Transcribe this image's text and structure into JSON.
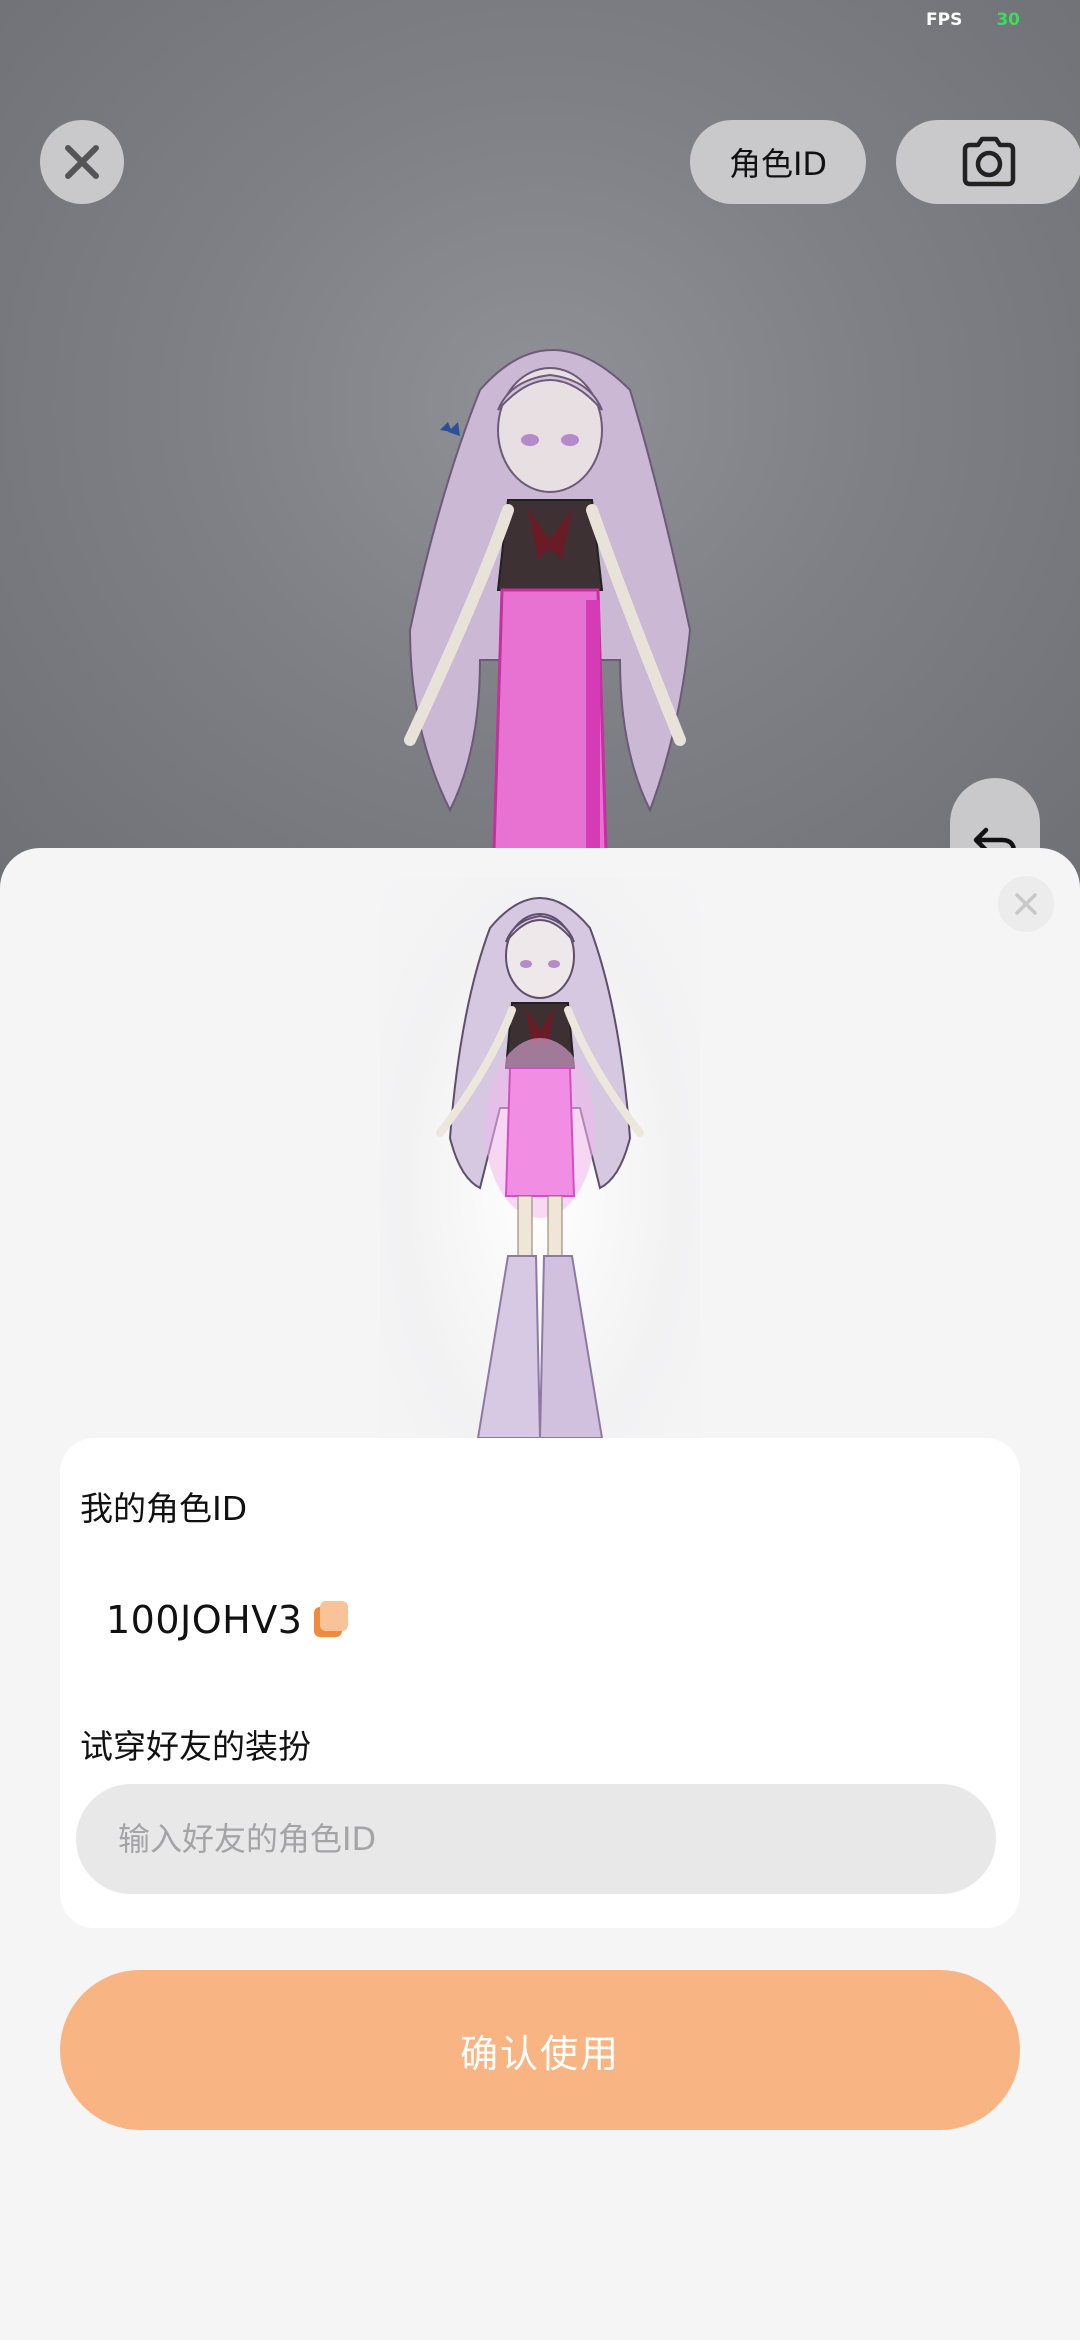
{
  "status": {
    "fps_label": "FPS",
    "fps_value": "30"
  },
  "top_bar": {
    "role_id_label": "角色ID"
  },
  "sheet": {
    "my_role_id_label": "我的角色ID",
    "my_role_id_value": "100JOHV3",
    "try_on_label": "试穿好友的装扮",
    "friend_id_placeholder": "输入好友的角色ID",
    "friend_id_value": "",
    "confirm_label": "确认使用"
  },
  "colors": {
    "accent": "#f8b583",
    "copy_icon": "#f08a3c",
    "fps_value": "#3ddc5a",
    "skirt": "#f07ad8"
  },
  "icons": [
    "close-icon",
    "camera-icon",
    "undo-icon",
    "copy-icon"
  ]
}
